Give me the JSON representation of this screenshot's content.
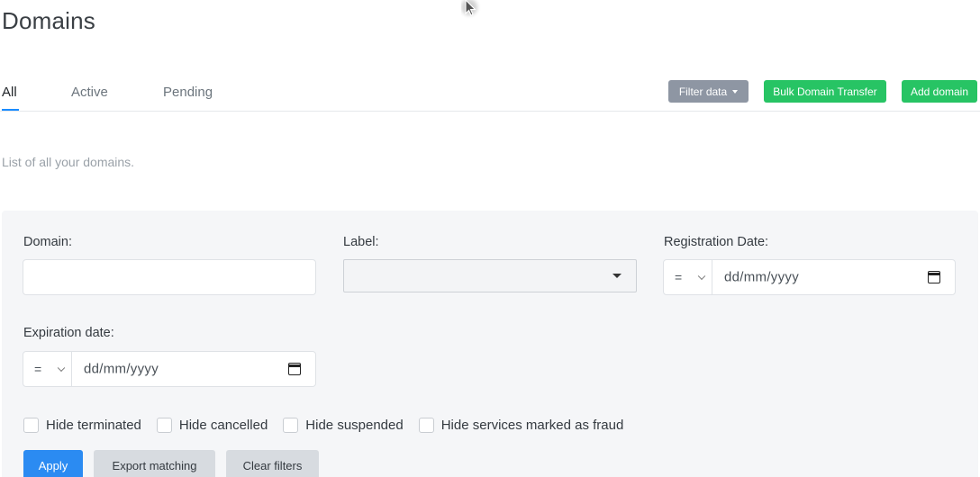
{
  "page": {
    "title": "Domains",
    "description": "List of all your domains."
  },
  "tabs": [
    {
      "label": "All",
      "active": true
    },
    {
      "label": "Active",
      "active": false
    },
    {
      "label": "Pending",
      "active": false
    }
  ],
  "actions": {
    "filter_label": "Filter data",
    "bulk_transfer_label": "Bulk Domain Transfer",
    "add_domain_label": "Add domain"
  },
  "filters": {
    "domain": {
      "label": "Domain:",
      "value": "",
      "placeholder": ""
    },
    "label": {
      "label": "Label:",
      "selected": ""
    },
    "registration_date": {
      "label": "Registration Date:",
      "operator": "=",
      "placeholder": "dd/mm/yyyy"
    },
    "expiration_date": {
      "label": "Expiration date:",
      "operator": "=",
      "placeholder": "dd/mm/yyyy"
    },
    "checkboxes": [
      {
        "label": "Hide terminated",
        "checked": false
      },
      {
        "label": "Hide cancelled",
        "checked": false
      },
      {
        "label": "Hide suspended",
        "checked": false
      },
      {
        "label": "Hide services marked as fraud",
        "checked": false
      }
    ],
    "apply_label": "Apply",
    "export_label": "Export matching",
    "clear_label": "Clear filters"
  },
  "colors": {
    "primary": "#2b8bf2",
    "success": "#27c464",
    "secondary": "#8e96a3",
    "tab_active_underline": "#1a8cff"
  },
  "icons": {
    "cursor": "mouse-cursor-icon",
    "calendar": "calendar-icon",
    "dropdown": "caret-down-icon"
  }
}
